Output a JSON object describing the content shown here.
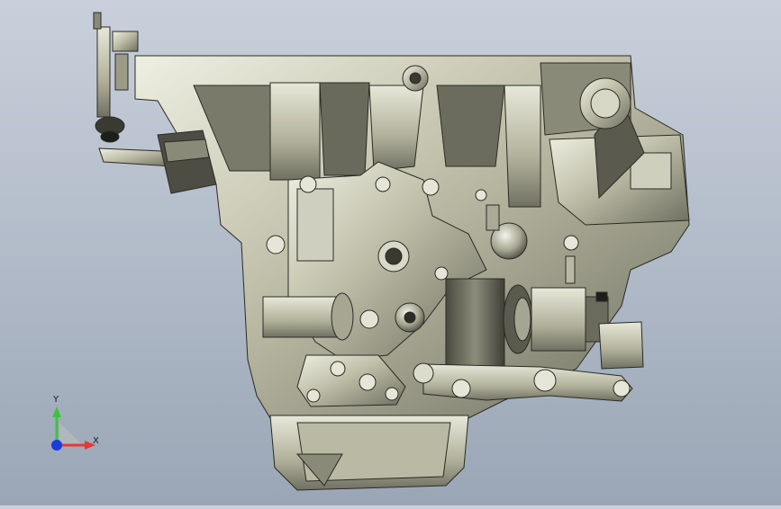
{
  "viewport": {
    "description_free": true,
    "background_top": "#c9d0db",
    "background_bottom": "#9aa6b6"
  },
  "triad": {
    "x_label": "X",
    "y_label": "Y",
    "x_color": "#e53935",
    "y_color": "#3cc43c",
    "z_color": "#1a3cdc"
  },
  "model": {
    "icon": "gearbox-model-icon",
    "housing_color": "#bfbfa8",
    "shadow_color": "#5e5e52"
  }
}
